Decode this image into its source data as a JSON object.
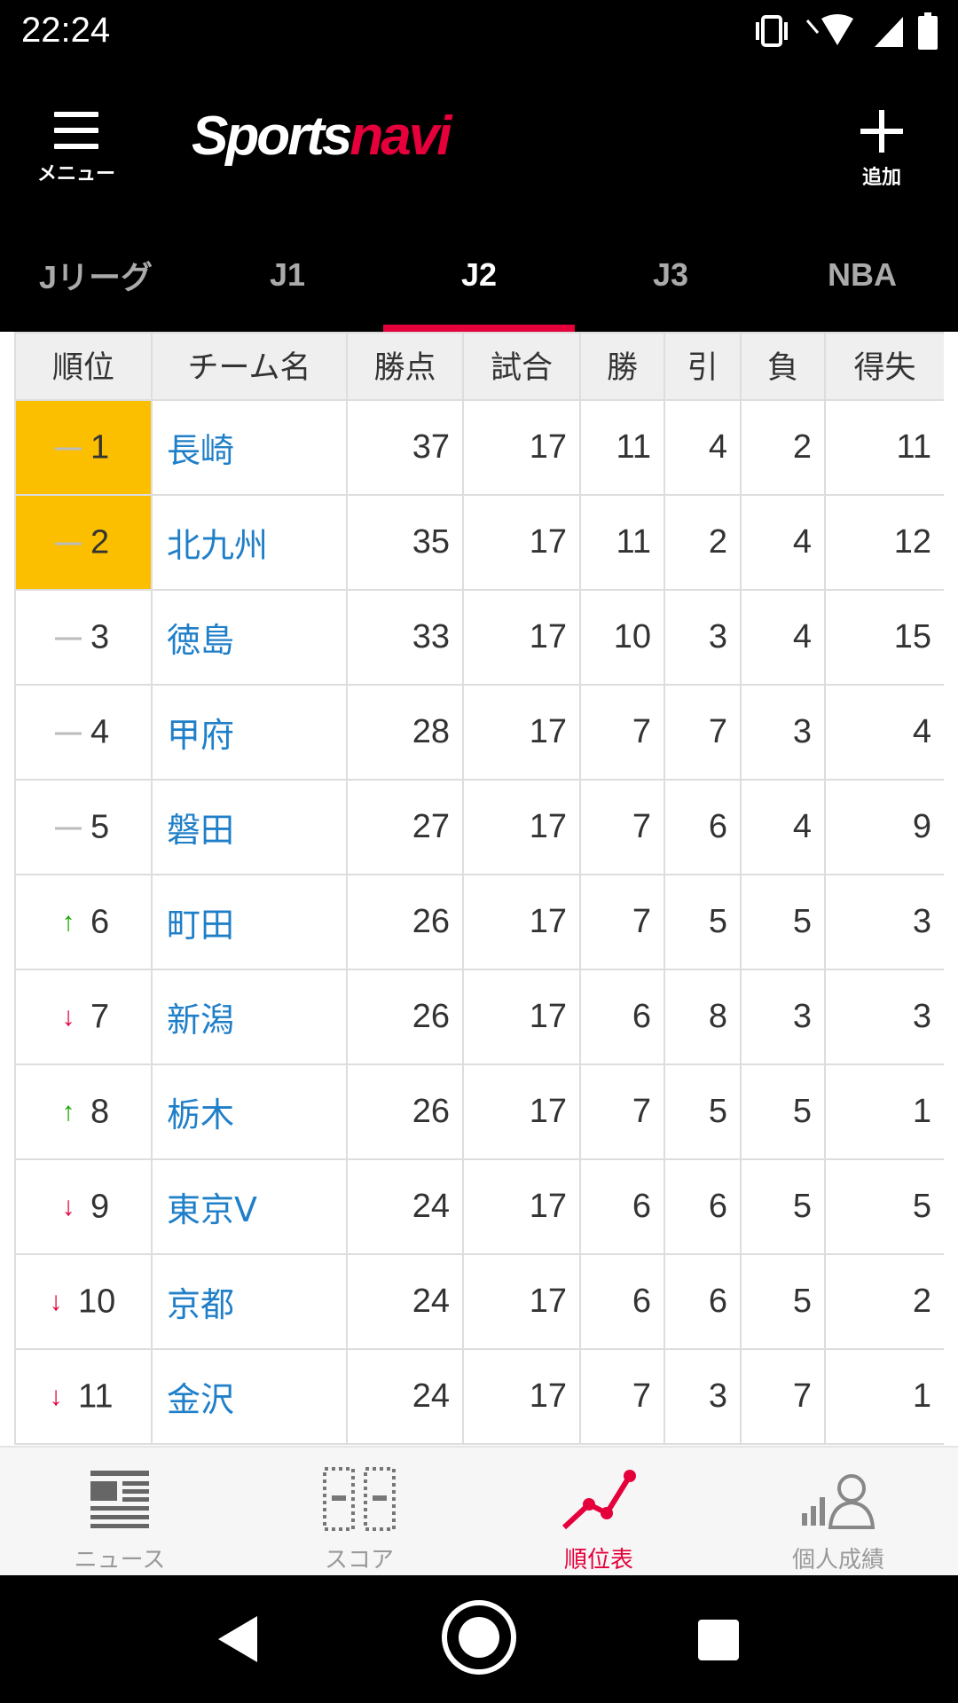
{
  "status_bar": {
    "time": "22:24"
  },
  "header": {
    "menu_label": "メニュー",
    "logo_part1": "Sports",
    "logo_part2": "navi",
    "add_label": "追加"
  },
  "tabs": [
    {
      "label": "Jリーグ",
      "active": false
    },
    {
      "label": "J1",
      "active": false
    },
    {
      "label": "J2",
      "active": true
    },
    {
      "label": "J3",
      "active": false
    },
    {
      "label": "NBA",
      "active": false
    }
  ],
  "table": {
    "headers": [
      "順位",
      "チーム名",
      "勝点",
      "試合",
      "勝",
      "引",
      "負",
      "得失"
    ],
    "rows": [
      {
        "trend": "same",
        "rank": "1",
        "team": "長崎",
        "pts": "37",
        "games": "17",
        "w": "11",
        "d": "4",
        "l": "2",
        "gd": "11",
        "highlight": true
      },
      {
        "trend": "same",
        "rank": "2",
        "team": "北九州",
        "pts": "35",
        "games": "17",
        "w": "11",
        "d": "2",
        "l": "4",
        "gd": "12",
        "highlight": true
      },
      {
        "trend": "same",
        "rank": "3",
        "team": "徳島",
        "pts": "33",
        "games": "17",
        "w": "10",
        "d": "3",
        "l": "4",
        "gd": "15",
        "highlight": false
      },
      {
        "trend": "same",
        "rank": "4",
        "team": "甲府",
        "pts": "28",
        "games": "17",
        "w": "7",
        "d": "7",
        "l": "3",
        "gd": "4",
        "highlight": false
      },
      {
        "trend": "same",
        "rank": "5",
        "team": "磐田",
        "pts": "27",
        "games": "17",
        "w": "7",
        "d": "6",
        "l": "4",
        "gd": "9",
        "highlight": false
      },
      {
        "trend": "up",
        "rank": "6",
        "team": "町田",
        "pts": "26",
        "games": "17",
        "w": "7",
        "d": "5",
        "l": "5",
        "gd": "3",
        "highlight": false
      },
      {
        "trend": "down",
        "rank": "7",
        "team": "新潟",
        "pts": "26",
        "games": "17",
        "w": "6",
        "d": "8",
        "l": "3",
        "gd": "3",
        "highlight": false
      },
      {
        "trend": "up",
        "rank": "8",
        "team": "栃木",
        "pts": "26",
        "games": "17",
        "w": "7",
        "d": "5",
        "l": "5",
        "gd": "1",
        "highlight": false
      },
      {
        "trend": "down",
        "rank": "9",
        "team": "東京V",
        "pts": "24",
        "games": "17",
        "w": "6",
        "d": "6",
        "l": "5",
        "gd": "5",
        "highlight": false
      },
      {
        "trend": "down",
        "rank": "10",
        "team": "京都",
        "pts": "24",
        "games": "17",
        "w": "6",
        "d": "6",
        "l": "5",
        "gd": "2",
        "highlight": false
      },
      {
        "trend": "down",
        "rank": "11",
        "team": "金沢",
        "pts": "24",
        "games": "17",
        "w": "7",
        "d": "3",
        "l": "7",
        "gd": "1",
        "highlight": false
      }
    ]
  },
  "bottom_nav": [
    {
      "label": "ニュース",
      "icon": "news-icon",
      "active": false
    },
    {
      "label": "スコア",
      "icon": "score-icon",
      "active": false
    },
    {
      "label": "順位表",
      "icon": "standings-icon",
      "active": true
    },
    {
      "label": "個人成績",
      "icon": "player-stats-icon",
      "active": false
    }
  ],
  "colors": {
    "brand_red": "#e5003b",
    "highlight_yellow": "#fcbf00",
    "link_blue": "#1f7fc8",
    "trend_up": "#1ea500",
    "trend_down": "#e5003b"
  }
}
